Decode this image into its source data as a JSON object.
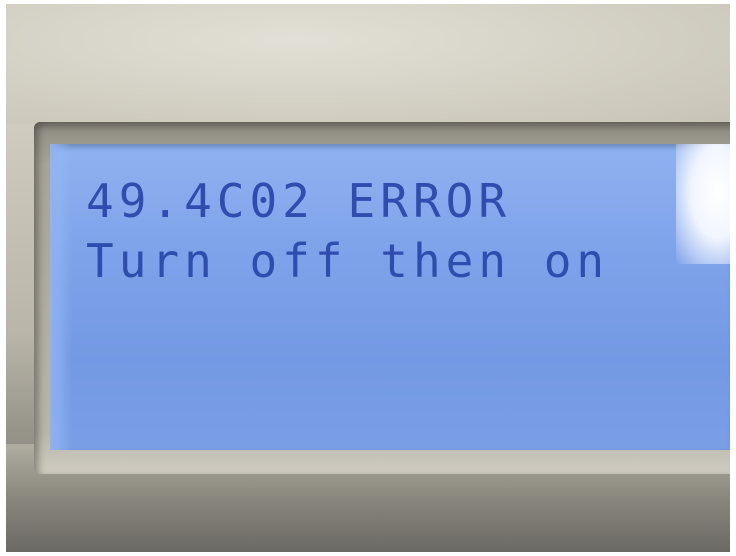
{
  "display": {
    "line1": "49.4C02 ERROR",
    "line2": "Turn off then on"
  },
  "colors": {
    "lcd_background": "#7fa3ea",
    "lcd_text": "#2f4dae",
    "bezel": "#d3d0c4"
  }
}
